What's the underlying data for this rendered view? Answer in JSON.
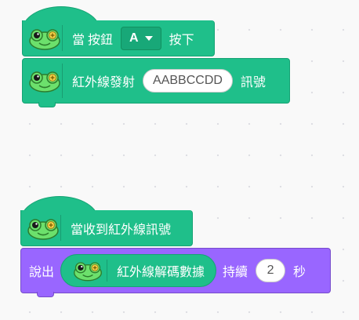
{
  "colors": {
    "event_green": "#1fbf8a",
    "looks_purple": "#9966ff",
    "frog_green": "#6ce06c"
  },
  "icons": {
    "frog": "frog-icon"
  },
  "script1": {
    "hat": {
      "when": "當",
      "button": "按鈕",
      "dropdown_value": "A",
      "pressed": "按下"
    },
    "ir_send": {
      "label": "紅外線發射",
      "value": "AABBCCDD",
      "suffix": "訊號"
    }
  },
  "script2": {
    "hat": {
      "label": "當收到紅外線訊號"
    },
    "say": {
      "label": "說出",
      "reporter_label": "紅外線解碼數據",
      "for_label": "持續",
      "seconds": "2",
      "seconds_unit": "秒"
    }
  }
}
